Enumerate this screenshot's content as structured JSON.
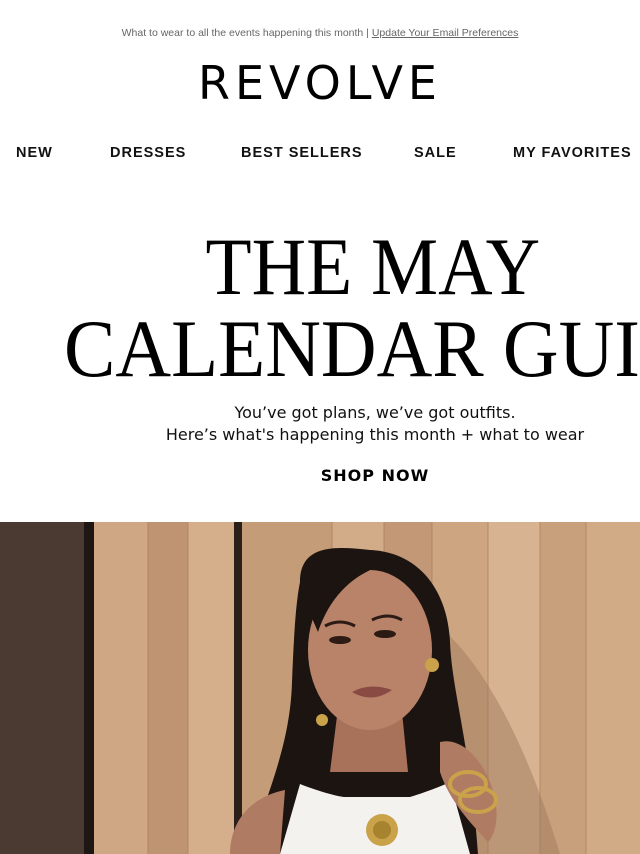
{
  "preheader": {
    "text": "What to wear to all the events happening this month | ",
    "link_label": "Update Your Email Preferences"
  },
  "brand": {
    "logo_text": "REVOLVE"
  },
  "nav": {
    "items": [
      {
        "label": "NEW"
      },
      {
        "label": "DRESSES"
      },
      {
        "label": "BEST SELLERS"
      },
      {
        "label": "SALE"
      },
      {
        "label": "MY FAVORITES"
      }
    ]
  },
  "hero_text": {
    "headline_line1": "THE MAY",
    "headline_line2": "CALENDAR GUIDE",
    "subcopy_line1": "You’ve got plans, we’ve got outfits.",
    "subcopy_line2": "Here’s what's happening this month + what to wear",
    "cta_label": "SHOP NOW"
  },
  "colors": {
    "wood": "#c9a27e",
    "wood_dark": "#4a3a31",
    "hair": "#1c1410",
    "skin": "#b9836a",
    "top": "#f4f2ee",
    "gold": "#c9a24a"
  }
}
